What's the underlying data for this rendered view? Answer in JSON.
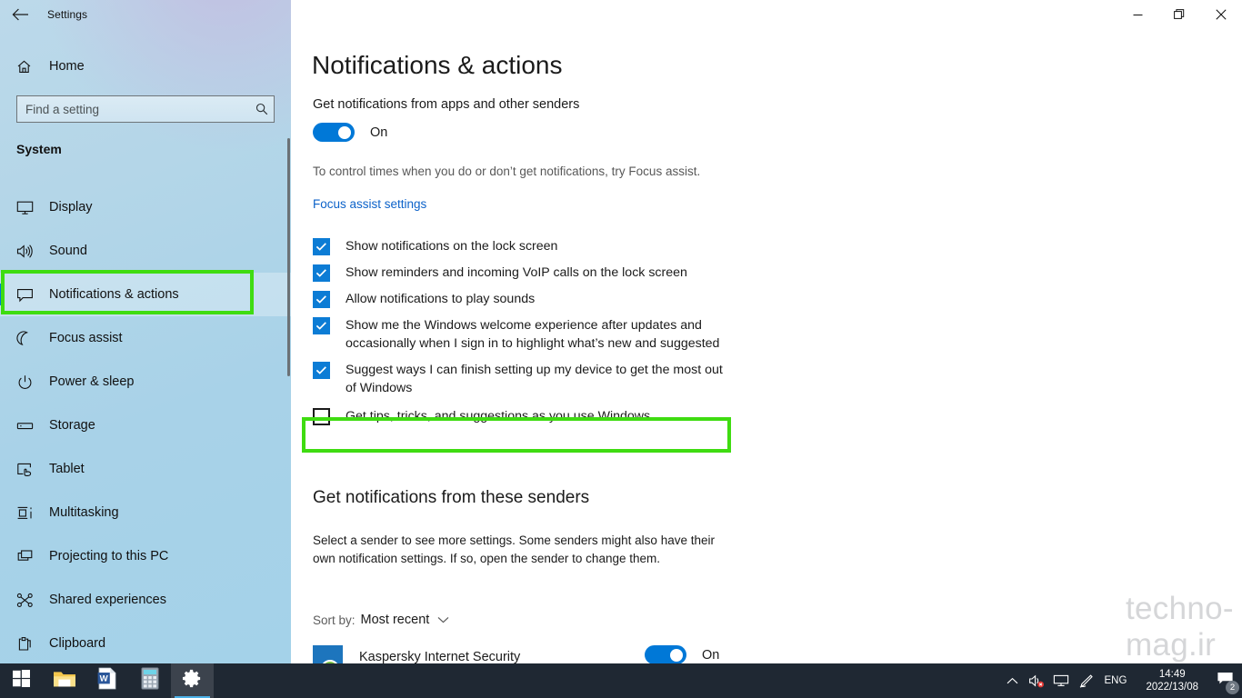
{
  "window": {
    "title": "Settings",
    "back_icon": "back-arrow-icon",
    "minimize_label": "Minimize",
    "restore_label": "Restore",
    "close_label": "Close"
  },
  "sidebar": {
    "home_label": "Home",
    "home_icon": "home-icon",
    "search": {
      "placeholder": "Find a setting",
      "value": "",
      "icon": "search-icon"
    },
    "group_title": "System",
    "items": [
      {
        "label": "Display",
        "icon": "monitor-icon"
      },
      {
        "label": "Sound",
        "icon": "speaker-icon"
      },
      {
        "label": "Notifications & actions",
        "icon": "chat-bubble-icon"
      },
      {
        "label": "Focus assist",
        "icon": "moon-icon"
      },
      {
        "label": "Power & sleep",
        "icon": "power-icon"
      },
      {
        "label": "Storage",
        "icon": "drive-icon"
      },
      {
        "label": "Tablet",
        "icon": "tablet-hand-icon"
      },
      {
        "label": "Multitasking",
        "icon": "multitasking-icon"
      },
      {
        "label": "Projecting to this PC",
        "icon": "project-screen-icon"
      },
      {
        "label": "Shared experiences",
        "icon": "share-nodes-icon"
      },
      {
        "label": "Clipboard",
        "icon": "clipboard-icon"
      }
    ],
    "selected_index": 2
  },
  "main": {
    "page_title": "Notifications & actions",
    "master_toggle": {
      "label": "Get notifications from apps and other senders",
      "state": "On"
    },
    "help_text": "To control times when you do or don’t get notifications, try Focus assist.",
    "link_label": "Focus assist settings",
    "checkboxes": [
      {
        "label": "Show notifications on the lock screen",
        "checked": true
      },
      {
        "label": "Show reminders and incoming VoIP calls on the lock screen",
        "checked": true
      },
      {
        "label": "Allow notifications to play sounds",
        "checked": true
      },
      {
        "label": "Show me the Windows welcome experience after updates and occasionally when I sign in to highlight what’s new and suggested",
        "checked": true
      },
      {
        "label": "Suggest ways I can finish setting up my device to get the most out of Windows",
        "checked": true
      },
      {
        "label": "Get tips, tricks, and suggestions as you use Windows",
        "checked": false
      }
    ],
    "senders": {
      "title": "Get notifications from these senders",
      "help_text": "Select a sender to see more settings. Some senders might also have their own notification settings. If so, open the sender to change them.",
      "sort_prefix": "Sort by:",
      "sort_value": "Most recent",
      "sort_caret_icon": "chevron-down-icon",
      "list": [
        {
          "name": "Kaspersky Internet Security",
          "state": "On",
          "icon": "kaspersky-icon"
        }
      ]
    },
    "watermark": "techno-mag.ir"
  },
  "highlights": {
    "color": "#3fdc11",
    "nav_target": "Notifications & actions",
    "checkbox_target": "Get tips, tricks, and suggestions as you use Windows"
  },
  "taskbar": {
    "items": [
      {
        "name": "start-button",
        "icon": "windows-logo-icon",
        "active": false
      },
      {
        "name": "file-explorer-button",
        "icon": "folder-icon",
        "active": false
      },
      {
        "name": "word-button",
        "icon": "word-document-icon",
        "active": false
      },
      {
        "name": "calculator-button",
        "icon": "calculator-icon",
        "active": false
      },
      {
        "name": "settings-button",
        "icon": "gear-icon",
        "active": true
      }
    ],
    "tray": {
      "overflow_icon": "chevron-up-icon",
      "volume_icon": "volume-muted-icon",
      "network_icon": "network-icon",
      "pen_icon": "pen-icon",
      "language": "ENG",
      "time": "14:49",
      "date": "2022/13/08",
      "action_center_icon": "action-center-icon",
      "notification_count": "2"
    }
  },
  "colors": {
    "accent": "#0078d7",
    "link": "#0c62c9",
    "highlight": "#3fdc11",
    "taskbar": "#1f2833",
    "checkbox": "#0c7cd5"
  }
}
